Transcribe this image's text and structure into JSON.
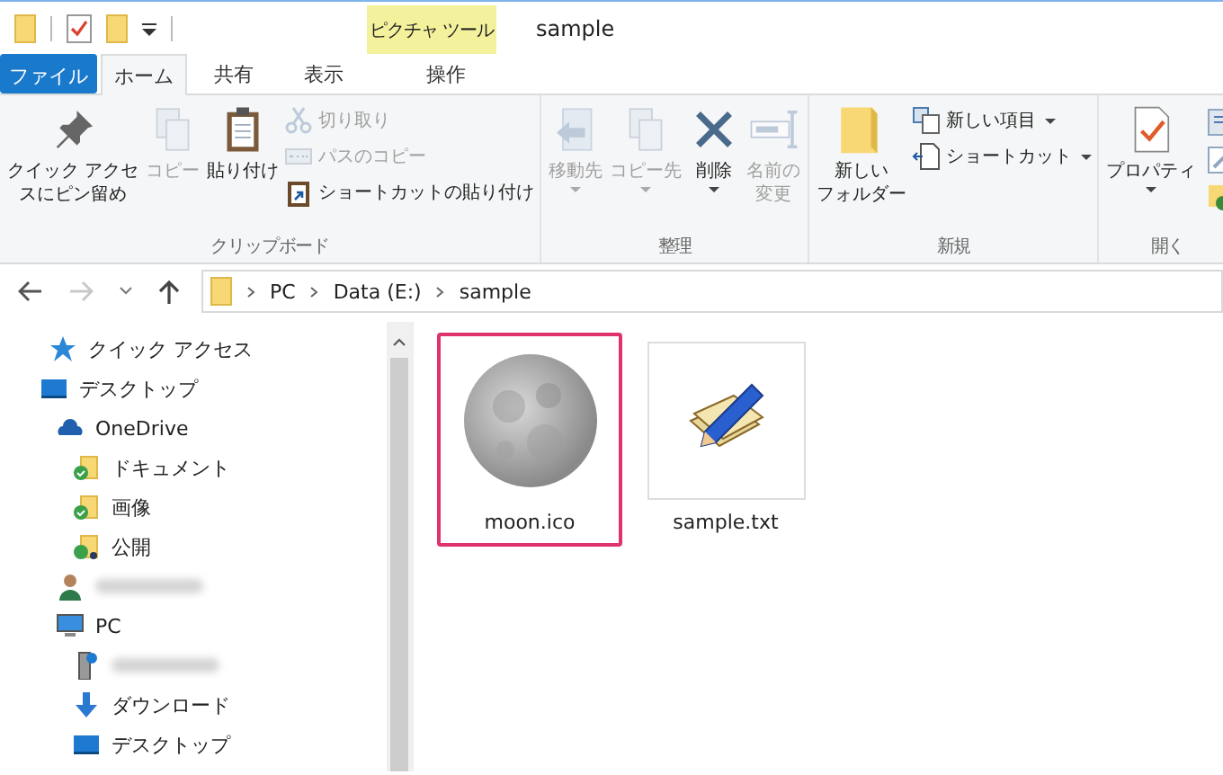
{
  "title_bar": {
    "contextual_tab": "ピクチャ ツール",
    "title": "sample"
  },
  "tabs": [
    {
      "label": "ファイル",
      "kind": "file",
      "selected": false
    },
    {
      "label": "ホーム",
      "kind": "normal",
      "selected": true
    },
    {
      "label": "共有",
      "kind": "normal",
      "selected": false
    },
    {
      "label": "表示",
      "kind": "normal",
      "selected": false
    },
    {
      "label": "操作",
      "kind": "contextual",
      "selected": false
    }
  ],
  "ribbon": {
    "groups": [
      {
        "label": "クリップボード",
        "items": [
          {
            "kind": "large",
            "lines": [
              "クイック アクセ",
              "スにピン留め"
            ],
            "disabled": false,
            "dropdown": false
          },
          {
            "kind": "large",
            "lines": [
              "コピー"
            ],
            "disabled": true,
            "dropdown": false
          },
          {
            "kind": "large",
            "lines": [
              "貼り付け"
            ],
            "disabled": false,
            "dropdown": false
          },
          {
            "kind": "small",
            "entries": [
              {
                "label": "切り取り",
                "disabled": true,
                "dropdown": false
              },
              {
                "label": "パスのコピー",
                "disabled": true,
                "dropdown": false
              },
              {
                "label": "ショートカットの貼り付け",
                "disabled": false,
                "dropdown": false
              }
            ]
          }
        ]
      },
      {
        "label": "整理",
        "items": [
          {
            "kind": "large",
            "lines": [
              "移動先"
            ],
            "disabled": true,
            "dropdown": true
          },
          {
            "kind": "large",
            "lines": [
              "コピー先"
            ],
            "disabled": true,
            "dropdown": true
          },
          {
            "kind": "large",
            "lines": [
              "削除"
            ],
            "disabled": false,
            "dropdown": true
          },
          {
            "kind": "large",
            "lines": [
              "名前の",
              "変更"
            ],
            "disabled": true,
            "dropdown": false
          }
        ]
      },
      {
        "label": "新規",
        "items": [
          {
            "kind": "large",
            "lines": [
              "新しい",
              "フォルダー"
            ],
            "disabled": false,
            "dropdown": false
          },
          {
            "kind": "small",
            "entries": [
              {
                "label": "新しい項目",
                "disabled": false,
                "dropdown": true
              },
              {
                "label": "ショートカット",
                "disabled": false,
                "dropdown": true
              }
            ]
          }
        ]
      },
      {
        "label": "開く",
        "items": [
          {
            "kind": "large",
            "lines": [
              "プロパティ"
            ],
            "disabled": false,
            "dropdown": true
          },
          {
            "kind": "iconcol"
          }
        ]
      }
    ]
  },
  "address": {
    "forward_disabled": true,
    "path": [
      "PC",
      "Data (E:)",
      "sample"
    ]
  },
  "nav_tree": [
    {
      "label": "クイック アクセス",
      "kind": "star"
    },
    {
      "label": "デスクトップ",
      "kind": "desktop",
      "children": [
        {
          "label": "OneDrive",
          "kind": "cloud",
          "children": [
            {
              "label": "ドキュメント",
              "kind": "synced-folder"
            },
            {
              "label": "画像",
              "kind": "synced-folder"
            },
            {
              "label": "公開",
              "kind": "shared-folder"
            }
          ]
        },
        {
          "kind": "user"
        },
        {
          "label": "PC",
          "kind": "pc",
          "children": [
            {
              "kind": "device"
            },
            {
              "label": "ダウンロード",
              "kind": "download"
            },
            {
              "label": "デスクトップ",
              "kind": "desktop"
            }
          ]
        }
      ]
    }
  ],
  "files": [
    {
      "name": "moon.ico",
      "selected": true
    },
    {
      "name": "sample.txt",
      "selected": false
    }
  ]
}
